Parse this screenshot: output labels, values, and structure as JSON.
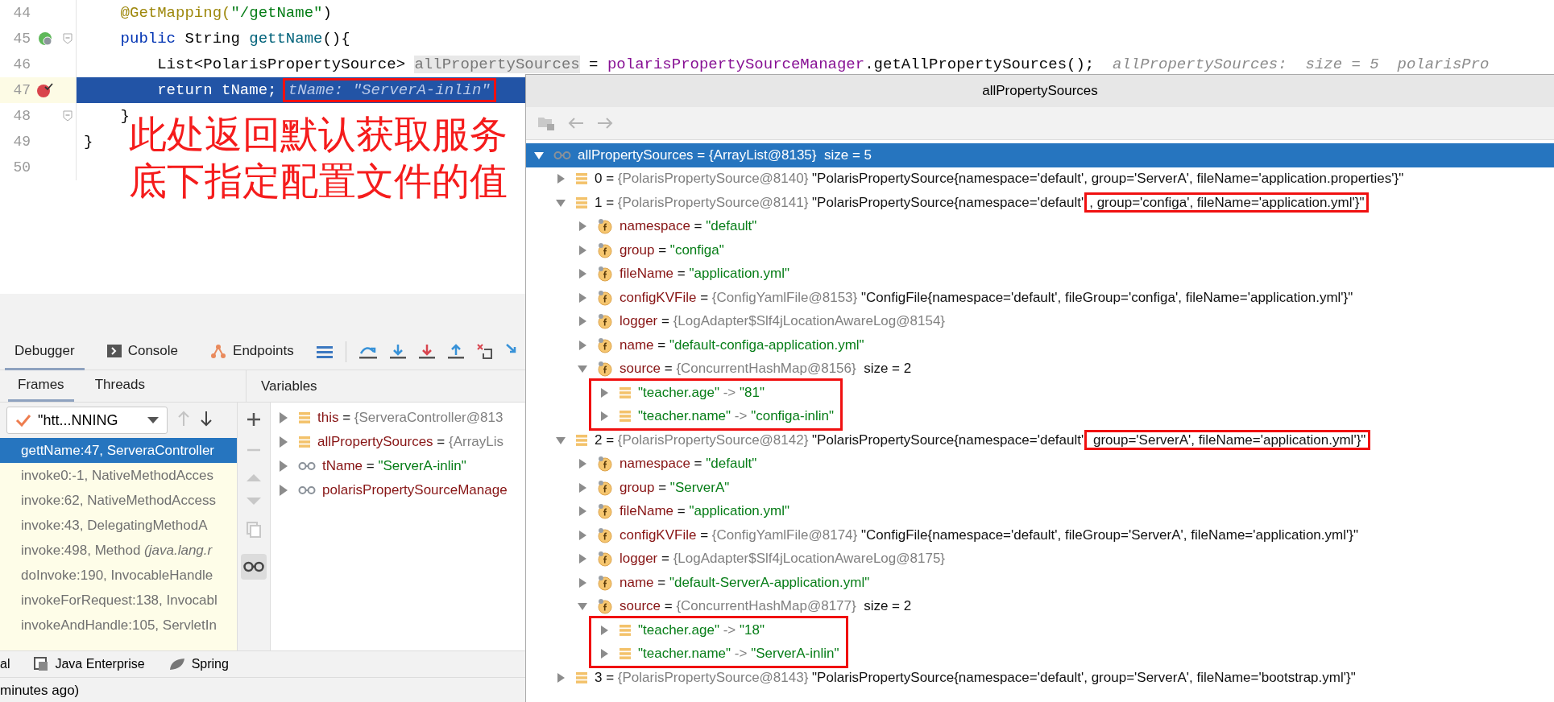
{
  "editor": {
    "lines": [
      {
        "number": "44",
        "current": false,
        "fold": false,
        "breakpoint": false,
        "endpoint": false,
        "parts": [
          {
            "kind": "annotation",
            "text": "    @GetMapping("
          },
          {
            "kind": "string",
            "text": "\"/getName\""
          },
          {
            "kind": "plain",
            "text": ")"
          }
        ]
      },
      {
        "number": "45",
        "current": false,
        "fold": true,
        "breakpoint": false,
        "endpoint": true,
        "parts": [
          {
            "kind": "keyword",
            "text": "    public"
          },
          {
            "kind": "plain",
            "text": " String "
          },
          {
            "kind": "method",
            "text": "gettName"
          },
          {
            "kind": "plain",
            "text": "(){"
          }
        ]
      },
      {
        "number": "46",
        "current": false,
        "fold": false,
        "breakpoint": false,
        "endpoint": false,
        "parts": [
          {
            "kind": "plain",
            "text": "        List<PolarisPropertySource> "
          },
          {
            "kind": "highlight",
            "text": "allPropertySources"
          },
          {
            "kind": "plain",
            "text": " = "
          },
          {
            "kind": "field",
            "text": "polarisPropertySourceManager"
          },
          {
            "kind": "plain",
            "text": ".getAllPropertySources();"
          },
          {
            "kind": "hint",
            "text": "  allPropertySources:  size = 5  polarisPro"
          }
        ]
      },
      {
        "number": "47",
        "current": true,
        "fold": false,
        "breakpoint": true,
        "endpoint": false,
        "parts": [
          {
            "kind": "plain",
            "text": "        return tName; "
          },
          {
            "kind": "boxed_hint",
            "text": "tName: \"ServerA-inlin\""
          }
        ]
      },
      {
        "number": "48",
        "current": false,
        "fold": true,
        "breakpoint": false,
        "endpoint": false,
        "parts": [
          {
            "kind": "plain",
            "text": "    }"
          }
        ]
      },
      {
        "number": "49",
        "current": false,
        "fold": false,
        "breakpoint": false,
        "endpoint": false,
        "parts": [
          {
            "kind": "plain",
            "text": "}"
          }
        ]
      },
      {
        "number": "50",
        "current": false,
        "fold": false,
        "breakpoint": false,
        "endpoint": false
      }
    ]
  },
  "callout": [
    "此处返回默认获取服务",
    "底下指定配置文件的值"
  ],
  "debugger": {
    "tabs": [
      {
        "label": "Debugger",
        "kind": "debugger",
        "selected": true
      },
      {
        "label": "Console",
        "kind": "console",
        "selected": false
      },
      {
        "label": "Endpoints",
        "kind": "endpoints",
        "selected": false
      }
    ],
    "subtabs": [
      {
        "label": "Frames",
        "selected": true
      },
      {
        "label": "Threads",
        "selected": false
      }
    ],
    "variables_header": "Variables",
    "thread": "\"htt...NNING",
    "frame_nav": [
      {
        "kind": "up",
        "disabled": true
      },
      {
        "kind": "down",
        "disabled": false
      }
    ],
    "frames": [
      {
        "text": "gettName:47, ServeraController",
        "selected": true
      },
      {
        "text": "invoke0:-1, NativeMethodAcces",
        "selected": false
      },
      {
        "text": "invoke:62, NativeMethodAccess",
        "selected": false
      },
      {
        "text": "invoke:43, DelegatingMethodA",
        "selected": false
      },
      {
        "text": "invoke:498, Method *(java.lang.r*",
        "selected": false
      },
      {
        "text": "doInvoke:190, InvocableHandle",
        "selected": false
      },
      {
        "text": "invokeForRequest:138, Invocabl",
        "selected": false
      },
      {
        "text": "invokeAndHandle:105, ServletIn",
        "selected": false
      }
    ],
    "variables": [
      {
        "kind": "entry",
        "expanded": false,
        "parts": [
          {
            "kind": "name",
            "text": "this"
          },
          {
            "kind": "op",
            "text": " = "
          },
          {
            "kind": "ref",
            "text": "{ServeraController@813"
          }
        ]
      },
      {
        "kind": "entry",
        "expanded": false,
        "parts": [
          {
            "kind": "name",
            "text": "allPropertySources"
          },
          {
            "kind": "op",
            "text": " = "
          },
          {
            "kind": "ref",
            "text": "{ArrayLis"
          }
        ]
      },
      {
        "kind": "watch",
        "expanded": false,
        "parts": [
          {
            "kind": "name",
            "text": "tName"
          },
          {
            "kind": "op",
            "text": " = "
          },
          {
            "kind": "string",
            "text": "\"ServerA-inlin\""
          }
        ]
      },
      {
        "kind": "watch",
        "expanded": false,
        "parts": [
          {
            "kind": "name",
            "text": "polarisPropertySourceManage"
          }
        ]
      }
    ]
  },
  "tool_windows": [
    {
      "label": "al",
      "kind": "terminal"
    },
    {
      "label": "Java Enterprise",
      "kind": "enterprise"
    },
    {
      "label": "Spring",
      "kind": "spring"
    }
  ],
  "status_bar": "minutes ago)",
  "popup": {
    "title": "allPropertySources",
    "tree": [
      {
        "kind": "watch",
        "expanded": true,
        "selected": true,
        "label": "allPropertySources = {ArrayList@8135}  size = 5",
        "children": [
          {
            "kind": "entry",
            "expanded": false,
            "selected": false,
            "parts": [
              {
                "kind": "index",
                "text": "0"
              },
              {
                "kind": "op",
                "text": " = "
              },
              {
                "kind": "ref",
                "text": "{PolarisPropertySource@8140}"
              },
              {
                "kind": "text",
                "text": " \"PolarisPropertySource{namespace='default', group='ServerA', fileName='application.properties'}\""
              }
            ]
          },
          {
            "kind": "entry",
            "expanded": true,
            "selected": false,
            "children_boxed": false,
            "parts": [
              {
                "kind": "index",
                "text": "1"
              },
              {
                "kind": "op",
                "text": " = "
              },
              {
                "kind": "ref",
                "text": "{PolarisPropertySource@8141}"
              },
              {
                "kind": "text",
                "text": " \"PolarisPropertySource{namespace='default'"
              },
              {
                "kind": "boxed_text",
                "text": ", group='configa', fileName='application.yml'}\""
              }
            ],
            "children": [
              {
                "kind": "field",
                "expanded": false,
                "selected": false,
                "parts": [
                  {
                    "kind": "name",
                    "text": "namespace"
                  },
                  {
                    "kind": "op",
                    "text": " = "
                  },
                  {
                    "kind": "string",
                    "text": "\"default\""
                  }
                ]
              },
              {
                "kind": "field",
                "expanded": false,
                "selected": false,
                "parts": [
                  {
                    "kind": "name",
                    "text": "group"
                  },
                  {
                    "kind": "op",
                    "text": " = "
                  },
                  {
                    "kind": "string",
                    "text": "\"configa\""
                  }
                ]
              },
              {
                "kind": "field",
                "expanded": false,
                "selected": false,
                "parts": [
                  {
                    "kind": "name",
                    "text": "fileName"
                  },
                  {
                    "kind": "op",
                    "text": " = "
                  },
                  {
                    "kind": "string",
                    "text": "\"application.yml\""
                  }
                ]
              },
              {
                "kind": "field",
                "expanded": false,
                "selected": false,
                "parts": [
                  {
                    "kind": "name",
                    "text": "configKVFile"
                  },
                  {
                    "kind": "op",
                    "text": " = "
                  },
                  {
                    "kind": "ref",
                    "text": "{ConfigYamlFile@8153}"
                  },
                  {
                    "kind": "text",
                    "text": " \"ConfigFile{namespace='default', fileGroup='configa', fileName='application.yml'}\""
                  }
                ]
              },
              {
                "kind": "field",
                "expanded": false,
                "selected": false,
                "parts": [
                  {
                    "kind": "name",
                    "text": "logger"
                  },
                  {
                    "kind": "op",
                    "text": " = "
                  },
                  {
                    "kind": "ref",
                    "text": "{LogAdapter$Slf4jLocationAwareLog@8154}"
                  }
                ]
              },
              {
                "kind": "field",
                "expanded": false,
                "selected": false,
                "parts": [
                  {
                    "kind": "name",
                    "text": "name"
                  },
                  {
                    "kind": "op",
                    "text": " = "
                  },
                  {
                    "kind": "string",
                    "text": "\"default-configa-application.yml\""
                  }
                ]
              },
              {
                "kind": "field",
                "expanded": true,
                "selected": false,
                "children_boxed": true,
                "parts": [
                  {
                    "kind": "name",
                    "text": "source"
                  },
                  {
                    "kind": "op",
                    "text": " = "
                  },
                  {
                    "kind": "ref",
                    "text": "{ConcurrentHashMap@8156}"
                  },
                  {
                    "kind": "text",
                    "text": "  size = 2"
                  }
                ],
                "children": [
                  {
                    "kind": "entry",
                    "expanded": false,
                    "selected": false,
                    "parts": [
                      {
                        "kind": "string",
                        "text": "\"teacher.age\""
                      },
                      {
                        "kind": "ref",
                        "text": " -> "
                      },
                      {
                        "kind": "string",
                        "text": "\"81\""
                      }
                    ]
                  },
                  {
                    "kind": "entry",
                    "expanded": false,
                    "selected": false,
                    "parts": [
                      {
                        "kind": "string",
                        "text": "\"teacher.name\""
                      },
                      {
                        "kind": "ref",
                        "text": " -> "
                      },
                      {
                        "kind": "string",
                        "text": "\"configa-inlin\""
                      }
                    ]
                  }
                ]
              }
            ]
          },
          {
            "kind": "entry",
            "expanded": true,
            "selected": false,
            "children_boxed": false,
            "parts": [
              {
                "kind": "index",
                "text": "2"
              },
              {
                "kind": "op",
                "text": " = "
              },
              {
                "kind": "ref",
                "text": "{PolarisPropertySource@8142}"
              },
              {
                "kind": "text",
                "text": " \"PolarisPropertySource{namespace='default'"
              },
              {
                "kind": "boxed_text",
                "text": " group='ServerA', fileName='application.yml'}\""
              }
            ],
            "children": [
              {
                "kind": "field",
                "expanded": false,
                "selected": false,
                "parts": [
                  {
                    "kind": "name",
                    "text": "namespace"
                  },
                  {
                    "kind": "op",
                    "text": " = "
                  },
                  {
                    "kind": "string",
                    "text": "\"default\""
                  }
                ]
              },
              {
                "kind": "field",
                "expanded": false,
                "selected": false,
                "parts": [
                  {
                    "kind": "name",
                    "text": "group"
                  },
                  {
                    "kind": "op",
                    "text": " = "
                  },
                  {
                    "kind": "string",
                    "text": "\"ServerA\""
                  }
                ]
              },
              {
                "kind": "field",
                "expanded": false,
                "selected": false,
                "parts": [
                  {
                    "kind": "name",
                    "text": "fileName"
                  },
                  {
                    "kind": "op",
                    "text": " = "
                  },
                  {
                    "kind": "string",
                    "text": "\"application.yml\""
                  }
                ]
              },
              {
                "kind": "field",
                "expanded": false,
                "selected": false,
                "parts": [
                  {
                    "kind": "name",
                    "text": "configKVFile"
                  },
                  {
                    "kind": "op",
                    "text": " = "
                  },
                  {
                    "kind": "ref",
                    "text": "{ConfigYamlFile@8174}"
                  },
                  {
                    "kind": "text",
                    "text": " \"ConfigFile{namespace='default', fileGroup='ServerA', fileName='application.yml'}\""
                  }
                ]
              },
              {
                "kind": "field",
                "expanded": false,
                "selected": false,
                "parts": [
                  {
                    "kind": "name",
                    "text": "logger"
                  },
                  {
                    "kind": "op",
                    "text": " = "
                  },
                  {
                    "kind": "ref",
                    "text": "{LogAdapter$Slf4jLocationAwareLog@8175}"
                  }
                ]
              },
              {
                "kind": "field",
                "expanded": false,
                "selected": false,
                "parts": [
                  {
                    "kind": "name",
                    "text": "name"
                  },
                  {
                    "kind": "op",
                    "text": " = "
                  },
                  {
                    "kind": "string",
                    "text": "\"default-ServerA-application.yml\""
                  }
                ]
              },
              {
                "kind": "field",
                "expanded": true,
                "selected": false,
                "children_boxed": true,
                "parts": [
                  {
                    "kind": "name",
                    "text": "source"
                  },
                  {
                    "kind": "op",
                    "text": " = "
                  },
                  {
                    "kind": "ref",
                    "text": "{ConcurrentHashMap@8177}"
                  },
                  {
                    "kind": "text",
                    "text": "  size = 2"
                  }
                ],
                "children": [
                  {
                    "kind": "entry",
                    "expanded": false,
                    "selected": false,
                    "parts": [
                      {
                        "kind": "string",
                        "text": "\"teacher.age\""
                      },
                      {
                        "kind": "ref",
                        "text": " -> "
                      },
                      {
                        "kind": "string",
                        "text": "\"18\""
                      }
                    ]
                  },
                  {
                    "kind": "entry",
                    "expanded": false,
                    "selected": false,
                    "parts": [
                      {
                        "kind": "string",
                        "text": "\"teacher.name\""
                      },
                      {
                        "kind": "ref",
                        "text": " -> "
                      },
                      {
                        "kind": "string",
                        "text": "\"ServerA-inlin\""
                      }
                    ]
                  }
                ]
              }
            ]
          },
          {
            "kind": "entry",
            "expanded": false,
            "selected": false,
            "parts": [
              {
                "kind": "index",
                "text": "3"
              },
              {
                "kind": "op",
                "text": " = "
              },
              {
                "kind": "ref",
                "text": "{PolarisPropertySource@8143}"
              },
              {
                "kind": "text",
                "text": " \"PolarisPropertySource{namespace='default', group='ServerA', fileName='bootstrap.yml'}\""
              }
            ]
          }
        ]
      }
    ]
  }
}
